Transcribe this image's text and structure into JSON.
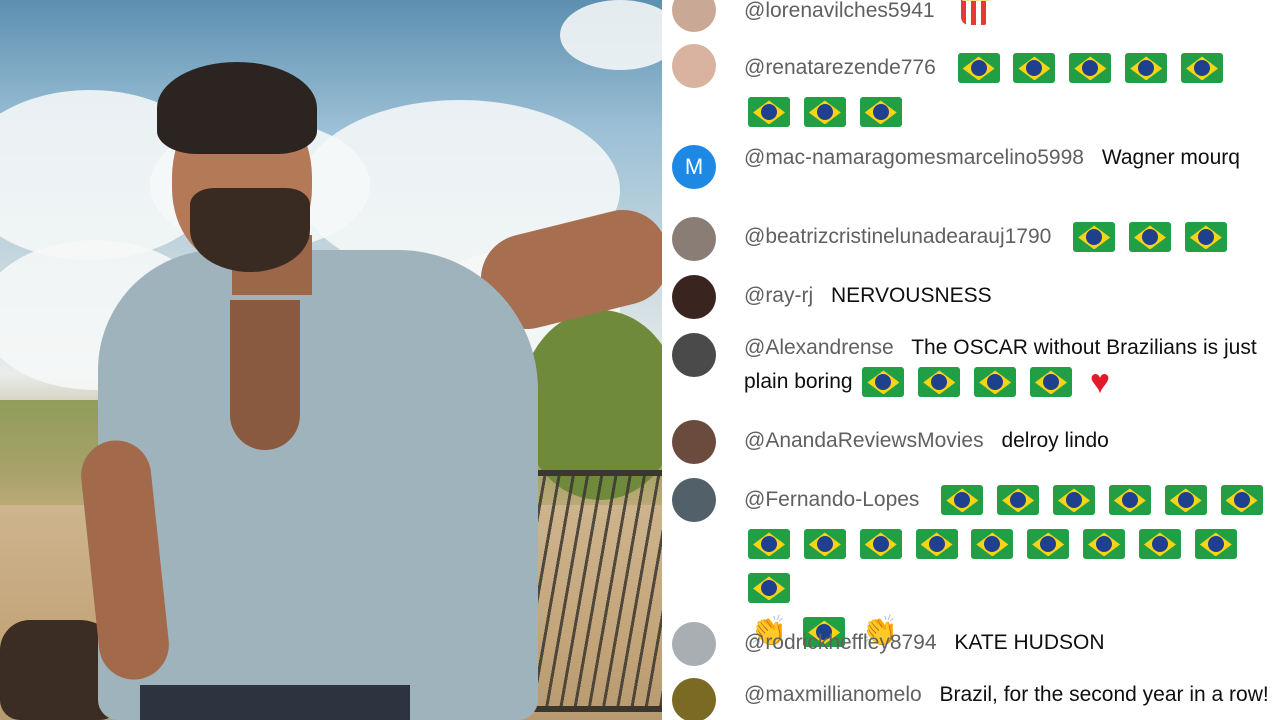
{
  "colors": {
    "author": "#606060",
    "text": "#0f0f0f",
    "avatar_m": "#1e88e5",
    "flag_green": "#229e45",
    "flag_yellow": "#f7d417",
    "flag_blue": "#1f3f8f",
    "heart": "#e21b2b"
  },
  "photo": {
    "icon": "man-leaning-photo"
  },
  "chat": {
    "messages": [
      {
        "author": "@lorenavilches5941",
        "text": "",
        "avatar_letter": "",
        "avatar_icon": "avatar-photo",
        "emoji_icon": "popcorn-icon"
      },
      {
        "author": "@renatarezende776",
        "text": "",
        "avatar_letter": "",
        "avatar_icon": "avatar-photo",
        "emoji_icon": "brazil-flag-icon"
      },
      {
        "author": "@mac-namaragomesmarcelino5998",
        "text": "Wagner mourq",
        "avatar_letter": "M",
        "avatar_icon": "letter-avatar"
      },
      {
        "author": "@beatrizcristinelunadearauj1790",
        "text": "",
        "avatar_letter": "",
        "avatar_icon": "avatar-photo",
        "emoji_icon": "brazil-flag-icon"
      },
      {
        "author": "@ray-rj",
        "text": "NERVOUSNESS",
        "avatar_letter": "",
        "avatar_icon": "avatar-photo"
      },
      {
        "author": "@Alexandrense",
        "text": "The OSCAR without Brazilians is just plain boring",
        "avatar_letter": "",
        "avatar_icon": "avatar-photo",
        "emoji_icon": "heart-icon"
      },
      {
        "author": "@AnandaReviewsMovies",
        "text": "delroy lindo",
        "avatar_letter": "",
        "avatar_icon": "avatar-photo"
      },
      {
        "author": "@Fernando-Lopes",
        "text": "",
        "avatar_letter": "",
        "avatar_icon": "avatar-photo",
        "emoji_icon": "clapping-hands-icon"
      },
      {
        "author": "@rodrickheffley8794",
        "text": "KATE HUDSON",
        "avatar_letter": "",
        "avatar_icon": "avatar-photo"
      },
      {
        "author": "@maxmillianomelo",
        "text": "Brazil, for the second year in a row!",
        "avatar_letter": "",
        "avatar_icon": "avatar-photo"
      }
    ]
  }
}
